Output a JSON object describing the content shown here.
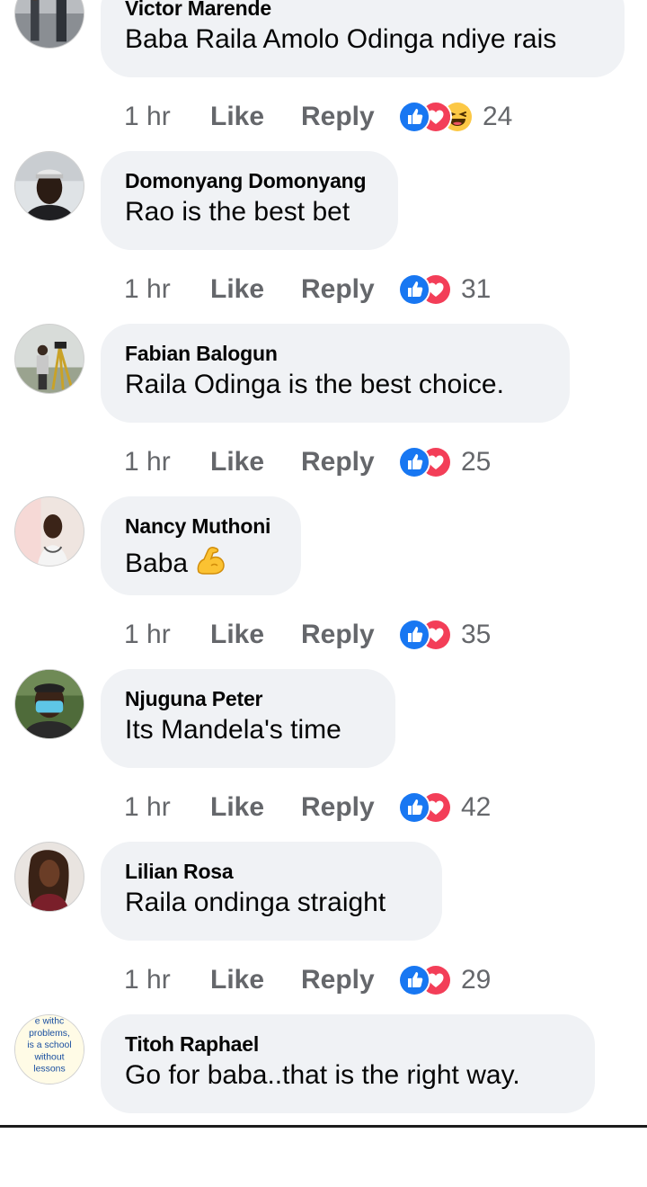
{
  "colors": {
    "bubble_bg": "#f0f2f5",
    "meta_text": "#65676b",
    "like_blue": "#1877f2",
    "love_red": "#f33e58",
    "haha_yellow": "#fcc845"
  },
  "comments": [
    {
      "author": "Victor Marende",
      "text": "Baba Raila Amolo Odinga ndiye rais",
      "time": "1 hr",
      "like_label": "Like",
      "reply_label": "Reply",
      "reactions": [
        "like-icon",
        "love-icon",
        "haha-icon"
      ],
      "reaction_count": "24"
    },
    {
      "author": "Domonyang Domonyang",
      "text": "Rao is the best bet",
      "time": "1 hr",
      "like_label": "Like",
      "reply_label": "Reply",
      "reactions": [
        "like-icon",
        "love-icon"
      ],
      "reaction_count": "31"
    },
    {
      "author": "Fabian Balogun",
      "text": "Raila Odinga is the best choice.",
      "time": "1 hr",
      "like_label": "Like",
      "reply_label": "Reply",
      "reactions": [
        "like-icon",
        "love-icon"
      ],
      "reaction_count": "25"
    },
    {
      "author": "Nancy Muthoni",
      "text": "Baba",
      "text_emoji": "flexed-biceps-emoji",
      "time": "1 hr",
      "like_label": "Like",
      "reply_label": "Reply",
      "reactions": [
        "like-icon",
        "love-icon"
      ],
      "reaction_count": "35"
    },
    {
      "author": "Njuguna Peter",
      "text": "Its Mandela's time",
      "time": "1 hr",
      "like_label": "Like",
      "reply_label": "Reply",
      "reactions": [
        "like-icon",
        "love-icon"
      ],
      "reaction_count": "42"
    },
    {
      "author": "Lilian Rosa",
      "text": "Raila ondinga straight",
      "time": "1 hr",
      "like_label": "Like",
      "reply_label": "Reply",
      "reactions": [
        "like-icon",
        "love-icon"
      ],
      "reaction_count": "29"
    },
    {
      "author": "Titoh Raphael",
      "text": "Go for baba..that is the right way.",
      "avatar_text": [
        "e withc",
        "problems,",
        "is a school",
        "without",
        "lessons"
      ]
    }
  ]
}
